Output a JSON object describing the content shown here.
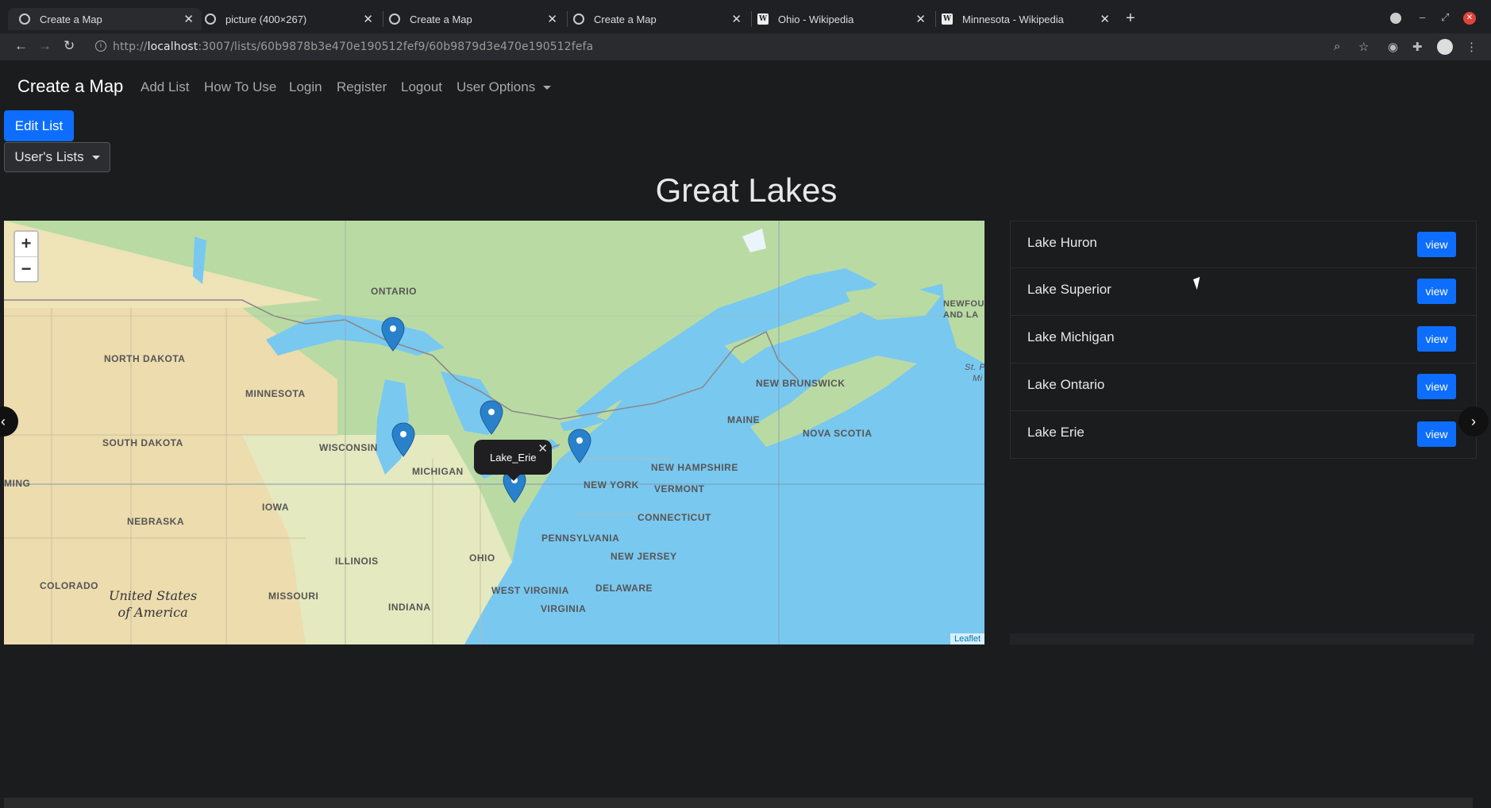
{
  "browser": {
    "tabs": [
      {
        "title": "Create a Map",
        "favicon": "globe-icon"
      },
      {
        "title": "picture (400×267)",
        "favicon": "globe-icon"
      },
      {
        "title": "Create a Map",
        "favicon": "globe-icon"
      },
      {
        "title": "Create a Map",
        "favicon": "globe-icon"
      },
      {
        "title": "Ohio - Wikipedia",
        "favicon": "wikipedia-icon"
      },
      {
        "title": "Minnesota - Wikipedia",
        "favicon": "wikipedia-icon"
      }
    ],
    "url_prefix": "http://",
    "url_host": "localhost",
    "url_rest": ":3007/lists/60b9878b3e470e190512fef9/60b9879d3e470e190512fefa"
  },
  "navbar": {
    "brand": "Create a Map",
    "links": [
      "Add List",
      "How To Use",
      "Login",
      "Register",
      "Logout"
    ],
    "user_options": "User Options"
  },
  "buttons": {
    "edit_list": "Edit List",
    "users_lists": "User's Lists"
  },
  "page_title": "Great Lakes",
  "map": {
    "popup_label": "Lake_Erie",
    "attribution": "Leaflet",
    "zoom_in": "+",
    "zoom_out": "−",
    "labels": {
      "ontario": "ONTARIO",
      "north_dakota": "NORTH DAKOTA",
      "minnesota": "MINNESOTA",
      "south_dakota": "SOUTH DAKOTA",
      "wisconsin": "WISCONSIN",
      "michigan": "MICHIGAN",
      "iowa": "IOWA",
      "nebraska": "NEBRASKA",
      "illinois": "ILLINOIS",
      "ohio": "OHIO",
      "indiana": "INDIANA",
      "missouri": "MISSOURI",
      "colorado": "COLORADO",
      "wyoming": "MING",
      "pennsylvania": "PENNSYLVANIA",
      "new_york": "NEW YORK",
      "vermont": "VERMONT",
      "new_hampshire": "NEW HAMPSHIRE",
      "maine": "MAINE",
      "new_brunswick": "NEW BRUNSWICK",
      "nova_scotia": "NOVA SCOTIA",
      "connecticut": "CONNECTICUT",
      "new_jersey": "NEW JERSEY",
      "west_virginia": "WEST VIRGINIA",
      "virginia": "VIRGINIA",
      "delaware": "DELAWARE",
      "newfoundland_1": "NEWFOU",
      "newfoundland_2": "AND LA",
      "st_p": "St. P",
      "mi": "Mi",
      "usa_1": "United States",
      "usa_2": "of America"
    }
  },
  "lakes": [
    {
      "name": "Lake Huron",
      "action": "view"
    },
    {
      "name": "Lake Superior",
      "action": "view"
    },
    {
      "name": "Lake Michigan",
      "action": "view"
    },
    {
      "name": "Lake Ontario",
      "action": "view"
    },
    {
      "name": "Lake Erie",
      "action": "view"
    }
  ],
  "colors": {
    "accent": "#0d6efd",
    "page_bg": "#1b1c1e",
    "water": "#79c8f0",
    "land_green": "#b9dba3",
    "land_tan": "#efe3b8"
  }
}
